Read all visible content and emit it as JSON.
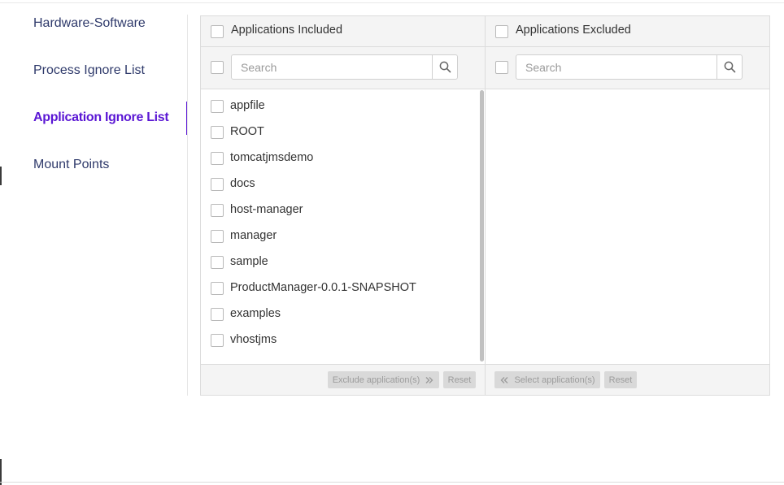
{
  "sidebar": {
    "items": [
      {
        "label": "Hardware-Software",
        "active": false
      },
      {
        "label": "Process Ignore List",
        "active": false
      },
      {
        "label": "Application Ignore List",
        "active": true
      },
      {
        "label": "Mount Points",
        "active": false
      }
    ]
  },
  "included": {
    "title": "Applications Included",
    "search_placeholder": "Search",
    "items": [
      "appfile",
      "ROOT",
      "tomcatjmsdemo",
      "docs",
      "host-manager",
      "manager",
      "sample",
      "ProductManager-0.0.1-SNAPSHOT",
      "examples",
      "vhostjms"
    ],
    "primary_button": "Exclude application(s)",
    "reset_button": "Reset"
  },
  "excluded": {
    "title": "Applications Excluded",
    "search_placeholder": "Search",
    "items": [],
    "primary_button": "Select application(s)",
    "reset_button": "Reset"
  },
  "icons": {
    "search": "search-icon",
    "move_right": "double-chevron-right-icon",
    "move_left": "double-chevron-left-icon"
  },
  "colors": {
    "active_nav": "#5a16d4",
    "nav_text": "#2f3a6b",
    "disabled_button_bg": "#d9d9d9",
    "disabled_button_text": "#9c9c9c",
    "panel_header_bg": "#f4f4f4"
  }
}
